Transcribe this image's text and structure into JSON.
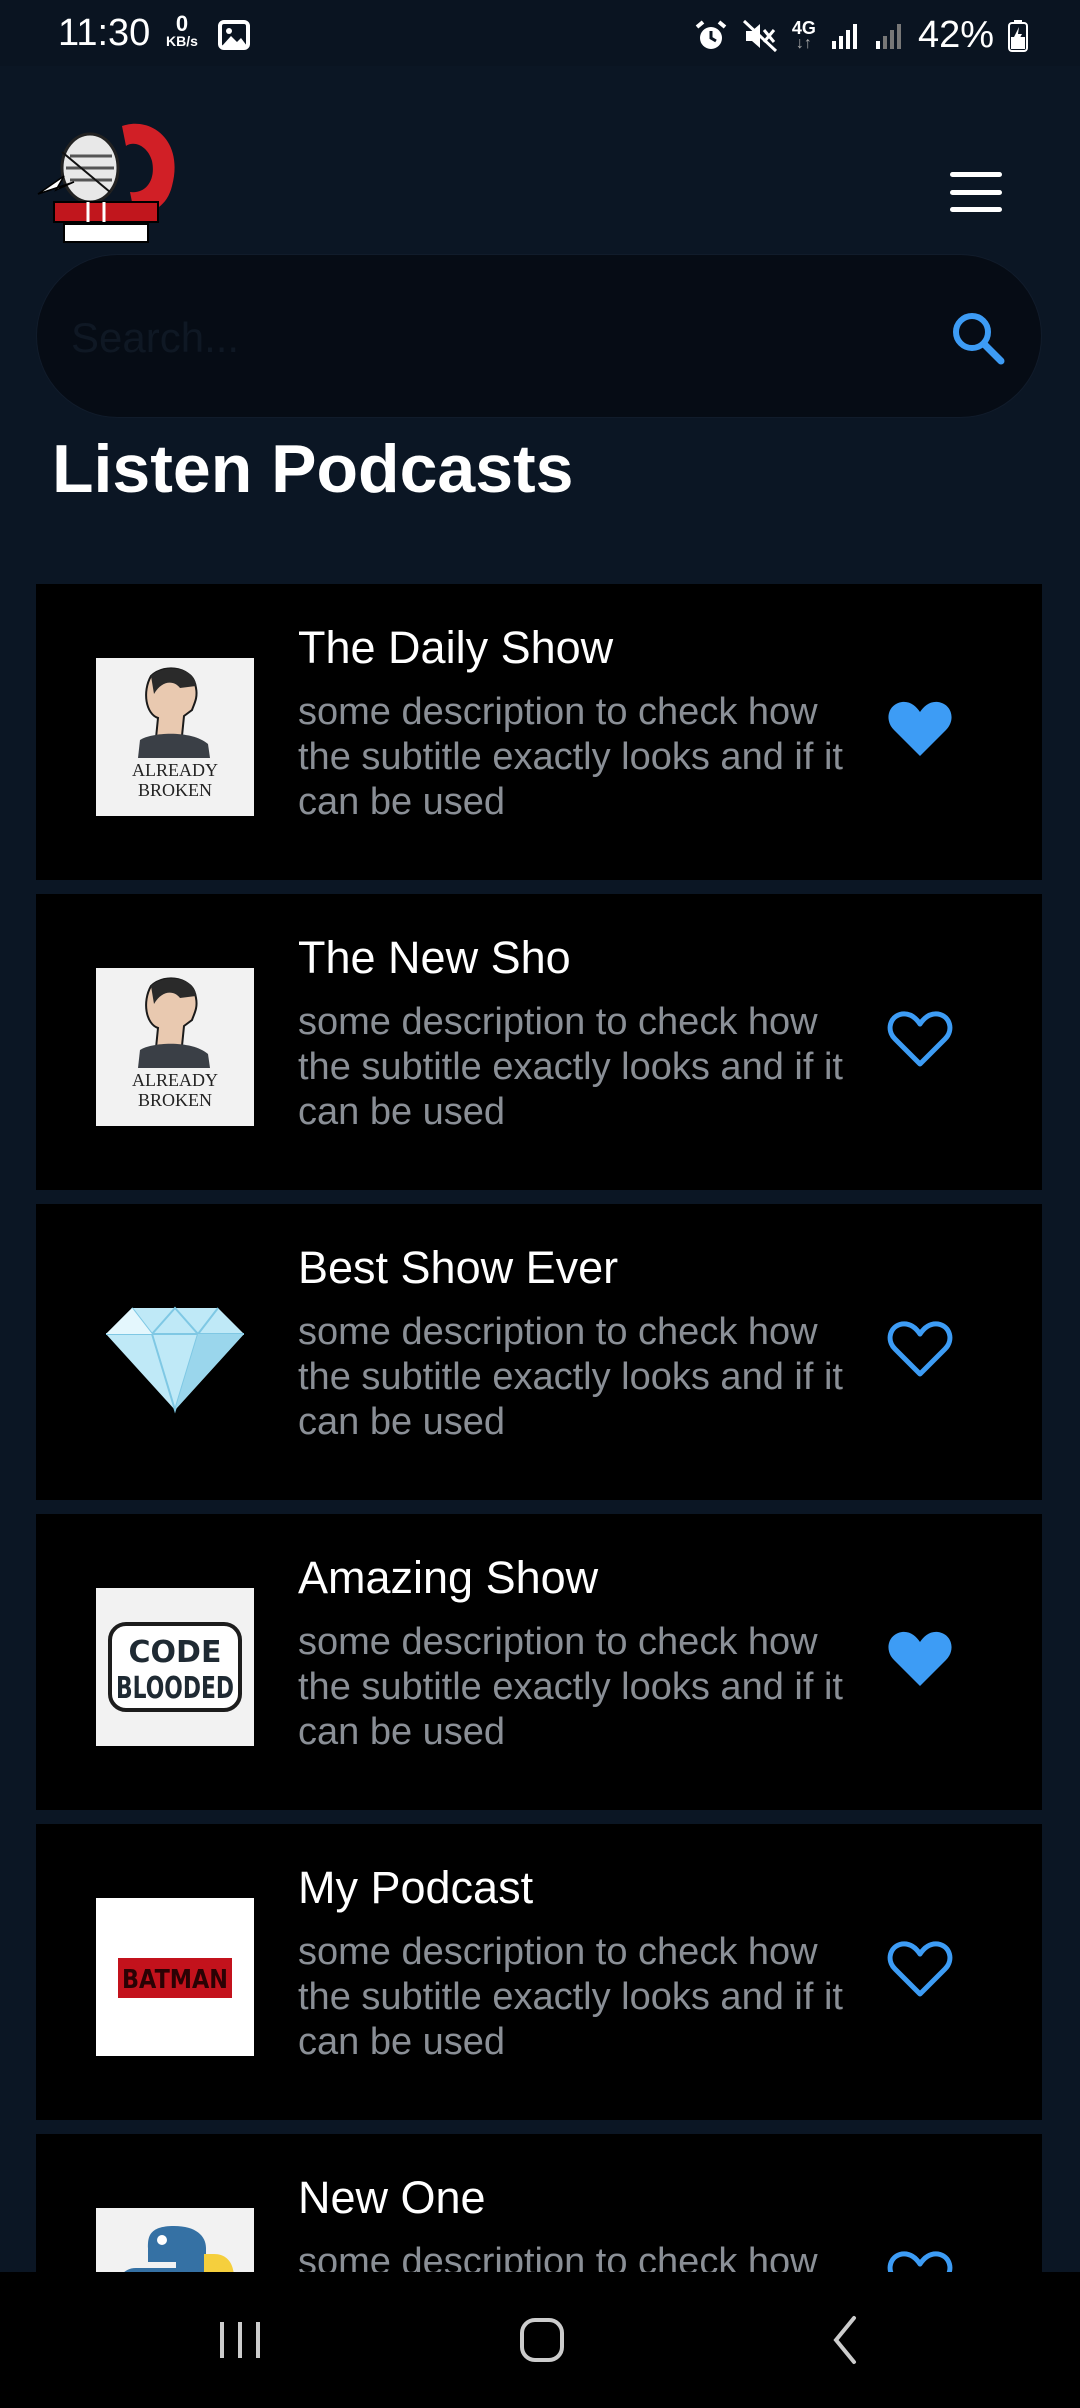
{
  "status_bar": {
    "time": "11:30",
    "data_rate_value": "0",
    "data_rate_unit": "KB/s",
    "network": "4G",
    "battery": "42%"
  },
  "header": {
    "logo_icon": "microphone-logo",
    "menu_icon": "hamburger-menu-icon"
  },
  "search": {
    "placeholder": "Search...",
    "icon": "search-icon"
  },
  "page_title": "Listen Podcasts",
  "podcasts": [
    {
      "title": "The Daily Show",
      "description": "some description to check how the subtitle exactly looks and if it can be used",
      "favorite": true,
      "thumbnail": "already-broken"
    },
    {
      "title": "The New Sho",
      "description": "some description to check how the subtitle exactly looks and if it can be used",
      "favorite": false,
      "thumbnail": "already-broken"
    },
    {
      "title": "Best Show Ever",
      "description": "some description to check how the subtitle exactly looks and if it can be used",
      "favorite": false,
      "thumbnail": "diamond"
    },
    {
      "title": "Amazing Show",
      "description": "some description to check how the subtitle exactly looks and if it can be used",
      "favorite": true,
      "thumbnail": "code-blooded"
    },
    {
      "title": "My Podcast",
      "description": "some description to check how the subtitle exactly looks and if it can be used",
      "favorite": false,
      "thumbnail": "batman"
    },
    {
      "title": "New One",
      "description": "some description to check how the subtitle exactly looks and if it can be used",
      "favorite": false,
      "thumbnail": "python"
    }
  ],
  "thumbnail_text": {
    "already_broken_line1": "ALREADY",
    "already_broken_line2": "BROKEN",
    "code_blooded_line1": "CODE",
    "code_blooded_line2": "BLOODED",
    "batman": "BATMAN"
  },
  "colors": {
    "background": "#0b1624",
    "card": "#000000",
    "accent": "#3d9cf5",
    "subtitle": "#8a8f96"
  },
  "nav_bar": {
    "recents_icon": "recents-icon",
    "home_icon": "home-icon",
    "back_icon": "back-icon"
  }
}
